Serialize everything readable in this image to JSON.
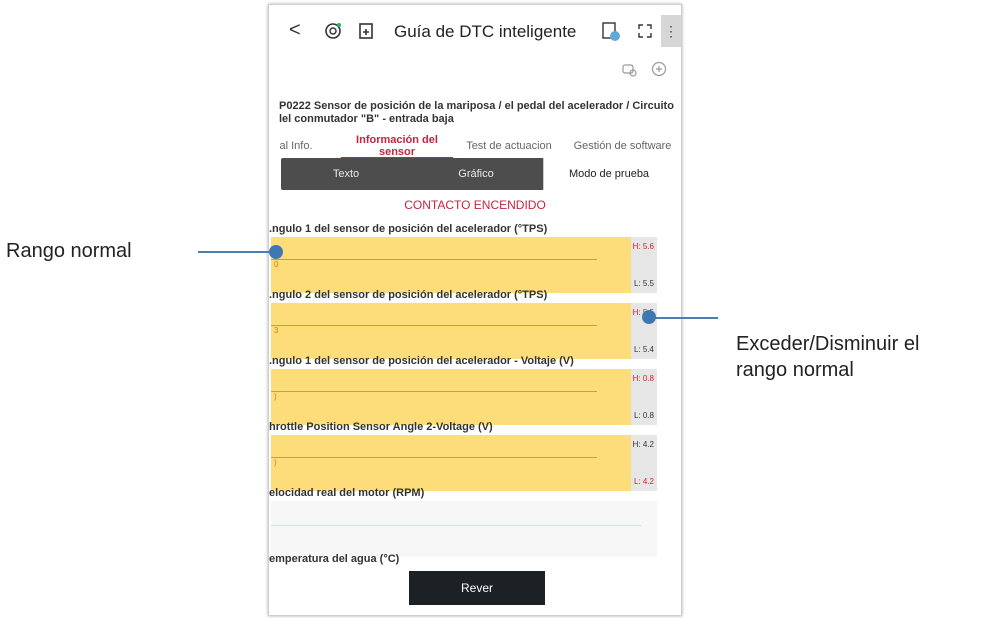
{
  "topbar": {
    "back": "<",
    "title": "Guía de DTC inteligente",
    "more": "⋮"
  },
  "dtc_text": "P0222 Sensor de posición de la mariposa / el pedal del acelerador / Circuito del conmutador \"B\" - entrada baja",
  "dtc_line1": "P0222 Sensor de posición de la mariposa / el pedal del acelerador / Circuito",
  "dtc_line2": "lel conmutador \"B\" - entrada baja",
  "tabs": [
    {
      "label": "al Info."
    },
    {
      "label": "Información del sensor"
    },
    {
      "label": "Test de actuacion"
    },
    {
      "label": "Gestión de software"
    }
  ],
  "segments": [
    "Texto",
    "Gráfico",
    "Modo de prueba"
  ],
  "status": "CONTACTO ENCENDIDO",
  "sensors": [
    {
      "title": ".ngulo 1 del sensor de posición del acelerador (°TPS)",
      "value": "0",
      "h": "H: 5.6",
      "l": "L: 5.5"
    },
    {
      "title": ".ngulo 2 del sensor de posición del acelerador (°TPS)",
      "value": "3",
      "h": "H: 5.5",
      "l": "L: 5.4"
    },
    {
      "title": ".ngulo 1 del sensor de posición del acelerador - Voltaje (V)",
      "value": ")",
      "h": "H: 0.8",
      "l": "L: 0.8"
    },
    {
      "title": "hrottle Position Sensor Angle 2-Voltage (V)",
      "value": ")",
      "h": "H: 4.2",
      "l": "L: 4.2"
    },
    {
      "title": "elocidad real del motor (RPM)",
      "value": "",
      "h": "",
      "l": ""
    },
    {
      "title": "emperatura del agua (°C)",
      "value": "",
      "h": "",
      "l": ""
    }
  ],
  "rever_label": "Rever",
  "annotations": {
    "left": "Rango normal",
    "right_line1": "Exceder/Disminuir  el",
    "right_line2": "rango normal"
  },
  "colors": {
    "accent": "#c8233f",
    "range_box": "#fddd7a",
    "annotation": "#3f77b3"
  }
}
